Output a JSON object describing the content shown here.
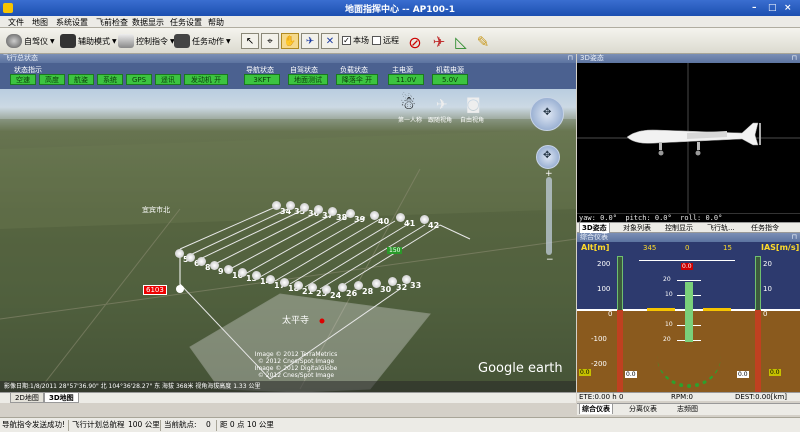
{
  "window": {
    "title": "地面指挥中心 -- AP100-1"
  },
  "menu": [
    "文件",
    "地图",
    "系统设置",
    "飞前检查",
    "数据显示",
    "任务设置",
    "帮助"
  ],
  "toolbar": {
    "autopilot": "自驾仪",
    "assist_mode": "辅助模式",
    "control_cmd": "控制指令",
    "task_action": "任务动作",
    "local_label": "本场",
    "remote_label": "远程",
    "local_checked": true,
    "remote_checked": false
  },
  "left_panel": {
    "header": "飞行总状态"
  },
  "status": {
    "group_status": "状态指示",
    "group_nav": "导航状态",
    "group_ctrl": "自驾状态",
    "group_load": "负载状态",
    "group_main_power": "主电源",
    "group_engine_power": "机载电源",
    "indicators": [
      "空速",
      "高度",
      "航姿",
      "系统",
      "GPS",
      "遥讯",
      "发动机 开"
    ],
    "nav_value": "3KFT",
    "ctrl_value": "地面测试",
    "load_value": "降落伞 开",
    "main_power_value": "11.0V",
    "engine_power_value": "5.0V"
  },
  "map": {
    "top_icons": [
      "第一人称",
      "跟随视角",
      "自由视角"
    ],
    "waypoint_labels": [
      "5",
      "6",
      "8",
      "9",
      "10",
      "13",
      "14",
      "17",
      "18",
      "21",
      "23",
      "24",
      "26",
      "28",
      "30",
      "32",
      "33",
      "34",
      "35",
      "36",
      "37",
      "38",
      "39",
      "40",
      "41",
      "42"
    ],
    "label_left": "宜宾市北",
    "marker_label": "6103",
    "mid_label": "150",
    "place_label": "太平寺",
    "copyright1": "Image © 2012 TerraMetrics",
    "copyright2": "© 2012 Cnes/Spot Image",
    "copyright3": "Image © 2012 DigitalGlobe",
    "copyright4": "© 2012 Cnes/Spot Image",
    "google": "Google earth",
    "coords": "影像日期:1/8/2011    28°57'36.90\" 北  104°36'28.27\" 东  海拔 368米    视角海拔高度 1.33 公里",
    "tabs": [
      "2D地图",
      "3D地图"
    ],
    "active_tab": "3D地图"
  },
  "right_panel": {
    "attitude_header": "3D姿态",
    "yaw": "yaw: 0.0°",
    "pitch": "pitch: 0.0°",
    "roll": "roll: 0.0°",
    "tabs": [
      "3D姿态",
      "对象列表",
      "控制显示",
      "飞行轨...",
      "任务指令"
    ],
    "pfd_header": "综合仪表",
    "alt_label": "Alt[m]",
    "ias_label": "IAS[m/s]",
    "heading_labels": [
      "345",
      "0",
      "15"
    ],
    "heading_value": "0.0",
    "alt_ticks": [
      "200",
      "100",
      "0",
      "-100",
      "-200"
    ],
    "ias_ticks": [
      "20",
      "10",
      "0"
    ],
    "pitch_ticks": [
      "20",
      "10",
      "10",
      "20"
    ],
    "alt_value": "0.0",
    "ias_value": "0.0",
    "left_small": "0.0",
    "right_small": "0.0",
    "ete": "ETE:0.00 h 0",
    "rpm": "RPM:0",
    "dest": "DEST:0.00[km]",
    "bottom_tabs": [
      "综合仪表",
      "分离仪表",
      "志频图"
    ]
  },
  "statusbar": {
    "msg": "导航指令发送成功!",
    "route_total_label": "飞行计划总航程",
    "route_total": "100 公里",
    "current_wp_label": "当前航点:",
    "current_wp": "0",
    "dist_label": "距 0 点 10 公里"
  },
  "colors": {
    "indicator_green": "#3cc440",
    "status_bg": "#4b6190",
    "pfd_sky": "#2d3a6e",
    "pfd_ground": "#8a5a1e"
  }
}
